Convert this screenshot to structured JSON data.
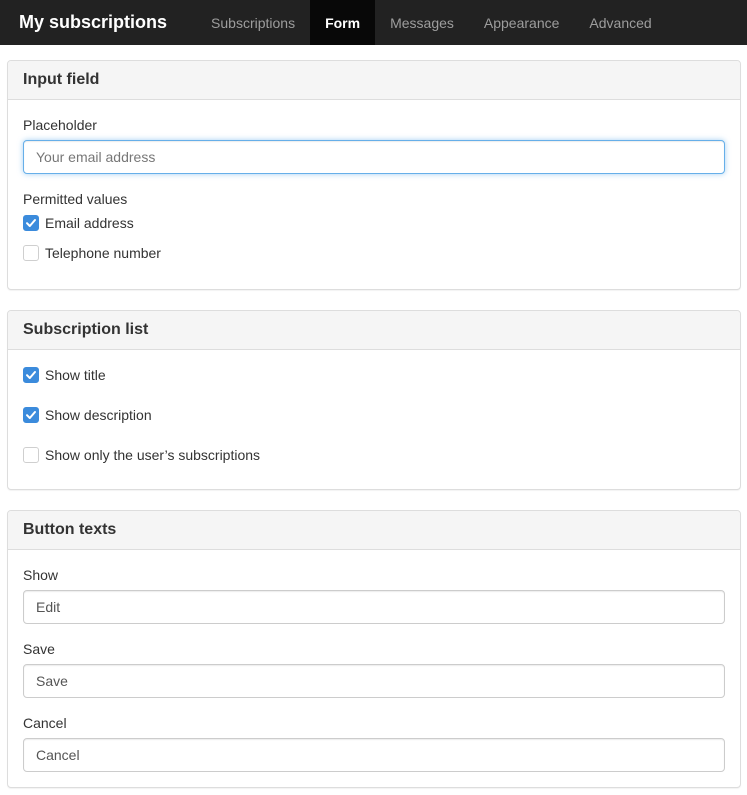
{
  "navbar": {
    "brand": "My subscriptions",
    "tabs": [
      {
        "label": "Subscriptions",
        "active": false
      },
      {
        "label": "Form",
        "active": true
      },
      {
        "label": "Messages",
        "active": false
      },
      {
        "label": "Appearance",
        "active": false
      },
      {
        "label": "Advanced",
        "active": false
      }
    ]
  },
  "input_field": {
    "title": "Input field",
    "placeholder_label": "Placeholder",
    "placeholder_value": "Your email address",
    "permitted_label": "Permitted values",
    "options": [
      {
        "label": "Email address",
        "checked": true
      },
      {
        "label": "Telephone number",
        "checked": false
      }
    ]
  },
  "subscription_list": {
    "title": "Subscription list",
    "options": [
      {
        "label": "Show title",
        "checked": true
      },
      {
        "label": "Show description",
        "checked": true
      },
      {
        "label": "Show only the user’s subscriptions",
        "checked": false
      }
    ]
  },
  "button_texts": {
    "title": "Button texts",
    "fields": [
      {
        "label": "Show",
        "value": "Edit"
      },
      {
        "label": "Save",
        "value": "Save"
      },
      {
        "label": "Cancel",
        "value": "Cancel"
      }
    ]
  },
  "colors": {
    "navbar_bg": "#222222",
    "active_tab_bg": "#080808",
    "checkbox_checked": "#3b8bdc",
    "focus_border": "#66afe9"
  }
}
